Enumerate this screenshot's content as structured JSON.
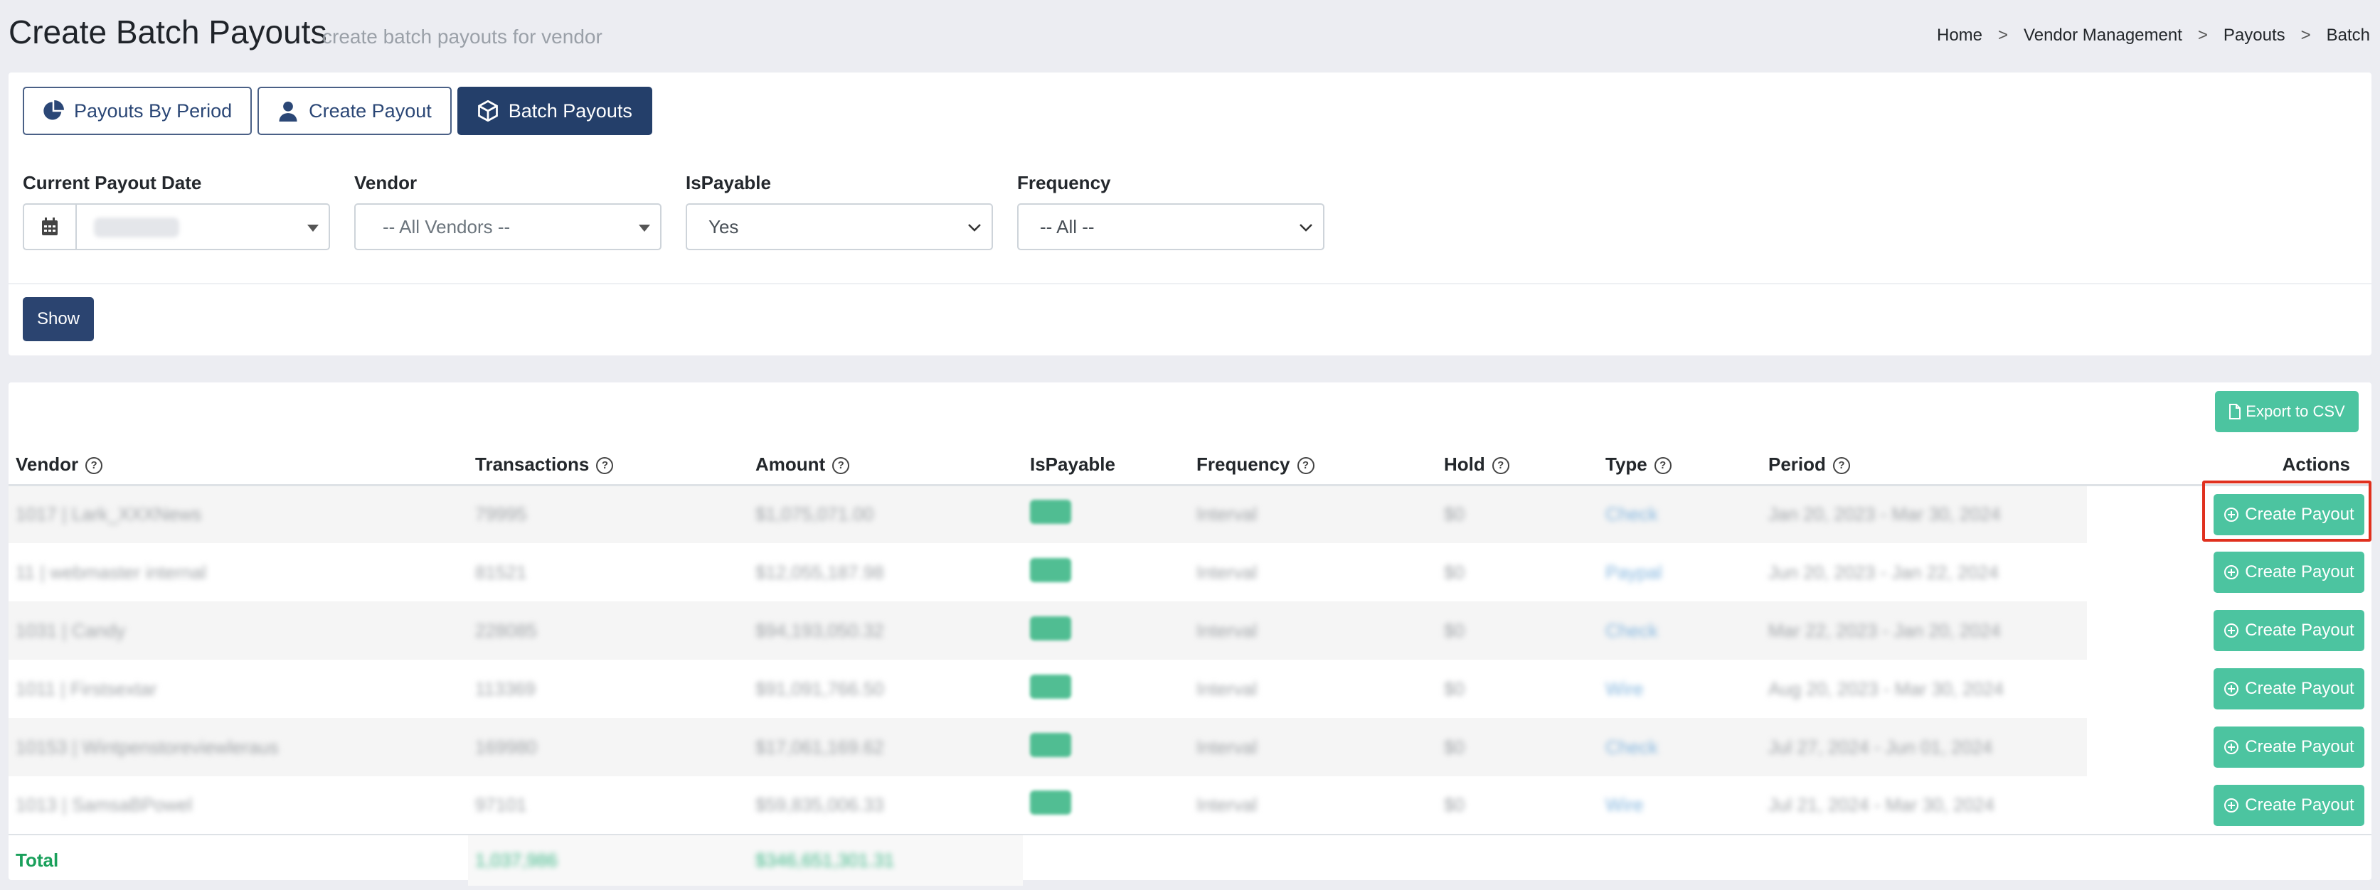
{
  "header": {
    "title": "Create Batch Payouts",
    "subtitle": "create batch payouts for vendor",
    "breadcrumb": [
      "Home",
      "Vendor Management",
      "Payouts",
      "Batch"
    ]
  },
  "tabs": [
    {
      "label": "Payouts By Period",
      "icon": "pie-chart-icon",
      "active": false
    },
    {
      "label": "Create Payout",
      "icon": "user-icon",
      "active": false
    },
    {
      "label": "Batch Payouts",
      "icon": "cubes-icon",
      "active": true
    }
  ],
  "filters": {
    "payout_date": {
      "label": "Current Payout Date",
      "value": "May 31"
    },
    "vendor": {
      "label": "Vendor",
      "placeholder": "-- All Vendors --"
    },
    "is_payable": {
      "label": "IsPayable",
      "value": "Yes"
    },
    "frequency": {
      "label": "Frequency",
      "value": "-- All --"
    }
  },
  "show_button": "Show",
  "export_button": "Export to CSV",
  "table": {
    "columns": [
      "Vendor",
      "Transactions",
      "Amount",
      "IsPayable",
      "Frequency",
      "Hold",
      "Type",
      "Period",
      "Actions"
    ],
    "rows": [
      {
        "vendor": "1017 | Lark_XXXNews",
        "transactions": "79995",
        "amount": "$1,075,071.00",
        "ispayable": "Yes",
        "frequency": "Interval",
        "hold": "$0",
        "type": "Check",
        "period": "Jan 20, 2023 - Mar 30, 2024",
        "action": "Create Payout"
      },
      {
        "vendor": "11 | webmaster internal",
        "transactions": "81521",
        "amount": "$12,055,187.98",
        "ispayable": "Yes",
        "frequency": "Interval",
        "hold": "$0",
        "type": "Paypal",
        "period": "Jun 20, 2023 - Jan 22, 2024",
        "action": "Create Payout"
      },
      {
        "vendor": "1031 | Candy",
        "transactions": "228085",
        "amount": "$94,193,050.32",
        "ispayable": "Yes",
        "frequency": "Interval",
        "hold": "$0",
        "type": "Check",
        "period": "Mar 22, 2023 - Jan 20, 2024",
        "action": "Create Payout"
      },
      {
        "vendor": "1011 | Firstsextar",
        "transactions": "113369",
        "amount": "$91,091,766.50",
        "ispayable": "Yes",
        "frequency": "Interval",
        "hold": "$0",
        "type": "Wire",
        "period": "Aug 20, 2023 - Mar 30, 2024",
        "action": "Create Payout"
      },
      {
        "vendor": "10153 | Wintpenstoreviewleraus",
        "transactions": "169980",
        "amount": "$17,061,169.62",
        "ispayable": "Yes",
        "frequency": "Interval",
        "hold": "$0",
        "type": "Check",
        "period": "Jul 27, 2024 - Jun 01, 2024",
        "action": "Create Payout"
      },
      {
        "vendor": "1013 | SamsaBPowel",
        "transactions": "97101",
        "amount": "$59,835,006.33",
        "ispayable": "Yes",
        "frequency": "Interval",
        "hold": "$0",
        "type": "Wire",
        "period": "Jul 21, 2024 - Mar 30, 2024",
        "action": "Create Payout"
      }
    ],
    "total": {
      "label": "Total",
      "transactions": "1,037,986",
      "amount": "$346,651,301.31"
    }
  },
  "colors": {
    "primary": "#243f6a",
    "success": "#4cc4a0",
    "highlight": "#e0301e"
  }
}
